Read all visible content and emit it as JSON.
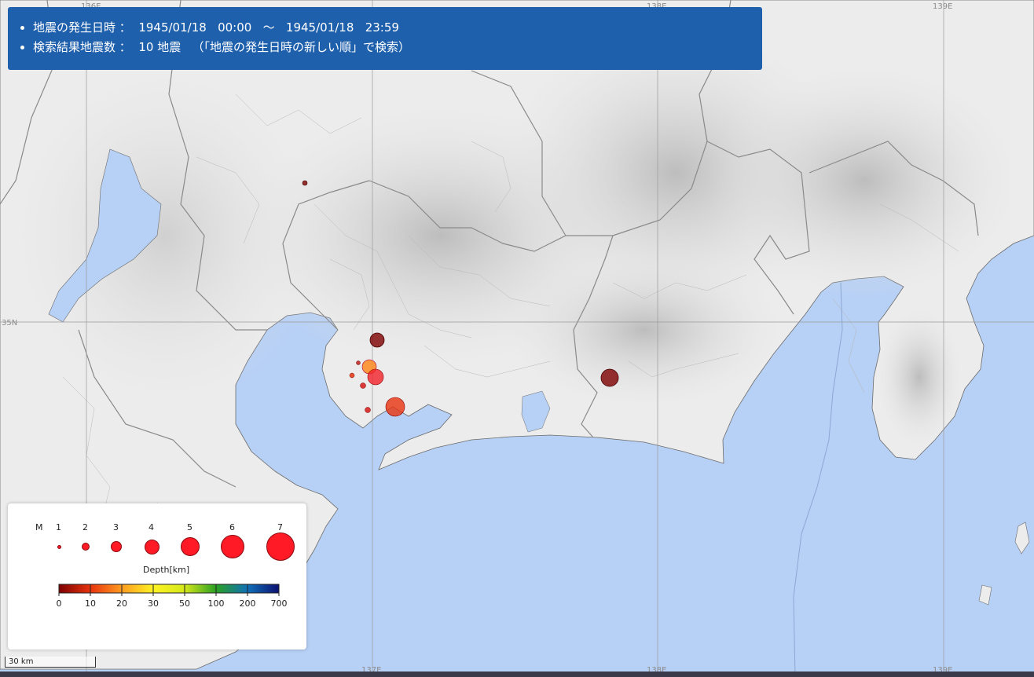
{
  "info": {
    "line1_label": "地震の発生日時",
    "line1_value": "：  1945/01/18   00:00   ～   1945/01/18   23:59",
    "line2_label": "検索結果地震数",
    "line2_value": "：  10 地震   （「地震の発生日時の新しい順」で検索）"
  },
  "grid_labels": {
    "lon_top": [
      "136E",
      "138E",
      "139E"
    ],
    "lon_bottom": [
      "137E",
      "138E",
      "139E"
    ],
    "lat": "35N"
  },
  "legend": {
    "magnitude_label": "M",
    "magnitudes": [
      "1",
      "2",
      "3",
      "4",
      "5",
      "6",
      "7"
    ],
    "depth_title": "Depth[km]",
    "depth_ticks": [
      "0",
      "10",
      "20",
      "30",
      "50",
      "100",
      "200",
      "700"
    ],
    "depth_colors": [
      "#7d0000",
      "#e8330e",
      "#ff9b20",
      "#fff224",
      "#d4e81a",
      "#2aa022",
      "#1070b8",
      "#0c1070"
    ]
  },
  "scale_bar": "30 km",
  "colors": {
    "info_bg": "#1f60ad",
    "sea": "#b7d0f5",
    "land": "#ededed"
  }
}
